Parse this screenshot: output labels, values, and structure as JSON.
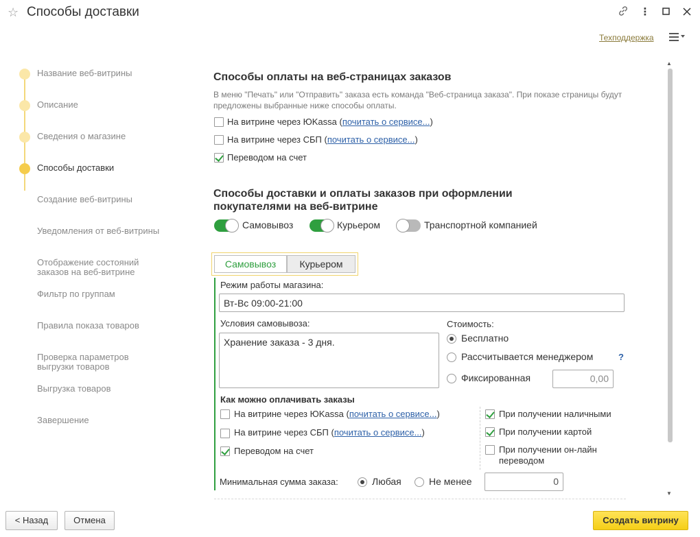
{
  "window": {
    "title": "Способы доставки",
    "support_link": "Техподдержка"
  },
  "steps": [
    {
      "label": "Название веб-витрины"
    },
    {
      "label": "Описание"
    },
    {
      "label": "Сведения о магазине"
    },
    {
      "label": "Способы доставки"
    },
    {
      "label": "Создание веб-витрины"
    },
    {
      "label": "Уведомления от веб-витрины"
    },
    {
      "label": "Отображение состояний заказов на веб-витрине"
    },
    {
      "label": "Фильтр по группам"
    },
    {
      "label": "Правила показа товаров"
    },
    {
      "label": "Проверка параметров выгрузки товаров"
    },
    {
      "label": "Выгрузка товаров"
    },
    {
      "label": "Завершение"
    }
  ],
  "payment_pages": {
    "heading": "Способы оплаты на веб-страницах заказов",
    "hint": "В меню \"Печать\" или \"Отправить\" заказа есть команда \"Веб-страница заказа\". При показе страницы будут предложены выбранные ниже способы оплаты.",
    "options": [
      {
        "label": "На витрине через ЮKassa (",
        "link": "почитать о сервисе...",
        "tail": ")",
        "checked": false
      },
      {
        "label": "На витрине через СБП  (",
        "link": "почитать о сервисе...",
        "tail": ")",
        "checked": false
      },
      {
        "label": "Переводом на счет",
        "checked": true
      }
    ]
  },
  "delivery": {
    "heading_line1": "Способы доставки и оплаты заказов при оформлении",
    "heading_line2": "покупателями на веб-витрине",
    "toggles": [
      {
        "label": "Самовывоз",
        "on": true
      },
      {
        "label": "Курьером",
        "on": true
      },
      {
        "label": "Транспортной компанией",
        "on": false
      }
    ],
    "tabs": [
      {
        "label": "Самовывоз",
        "active": true
      },
      {
        "label": "Курьером",
        "active": false
      }
    ]
  },
  "pickup": {
    "hours_label": "Режим работы магазина:",
    "hours_value": "Вт-Вс 09:00-21:00",
    "conditions_label": "Условия самовывоза:",
    "conditions_value": "Хранение заказа - 3 дня.",
    "cost_label": "Стоимость:",
    "cost_options": [
      {
        "label": "Бесплатно",
        "selected": true
      },
      {
        "label": "Рассчитывается менеджером",
        "selected": false
      },
      {
        "label": "Фиксированная",
        "selected": false
      }
    ],
    "help_mark": "?",
    "fixed_value": "0,00",
    "payment_heading": "Как можно оплачивать заказы",
    "online_options": [
      {
        "label": "На витрине через ЮKassa (",
        "link": "почитать о сервисе...",
        "tail": ")",
        "checked": false
      },
      {
        "label": "На витрине через СБП   (",
        "link": "почитать о сервисе...",
        "tail": ")",
        "checked": false
      },
      {
        "label": "Переводом на счет",
        "checked": true
      }
    ],
    "receipt_options": [
      {
        "label": "При получении наличными",
        "checked": true
      },
      {
        "label": "При получении картой",
        "checked": true
      },
      {
        "label": "При получении он-лайн переводом",
        "checked": false
      }
    ],
    "min_sum_label": "Минимальная сумма заказа:",
    "min_sum_options": [
      {
        "label": "Любая",
        "selected": true
      },
      {
        "label": "Не менее",
        "selected": false
      }
    ],
    "min_sum_value": "0"
  },
  "footer": {
    "back": "< Назад",
    "cancel": "Отмена",
    "create": "Создать витрину"
  },
  "colors": {
    "accent_green": "#2f9f3f",
    "step_yellow": "#f5cc4c",
    "primary_button": "#f5cf17",
    "link_blue": "#2e61a8"
  }
}
